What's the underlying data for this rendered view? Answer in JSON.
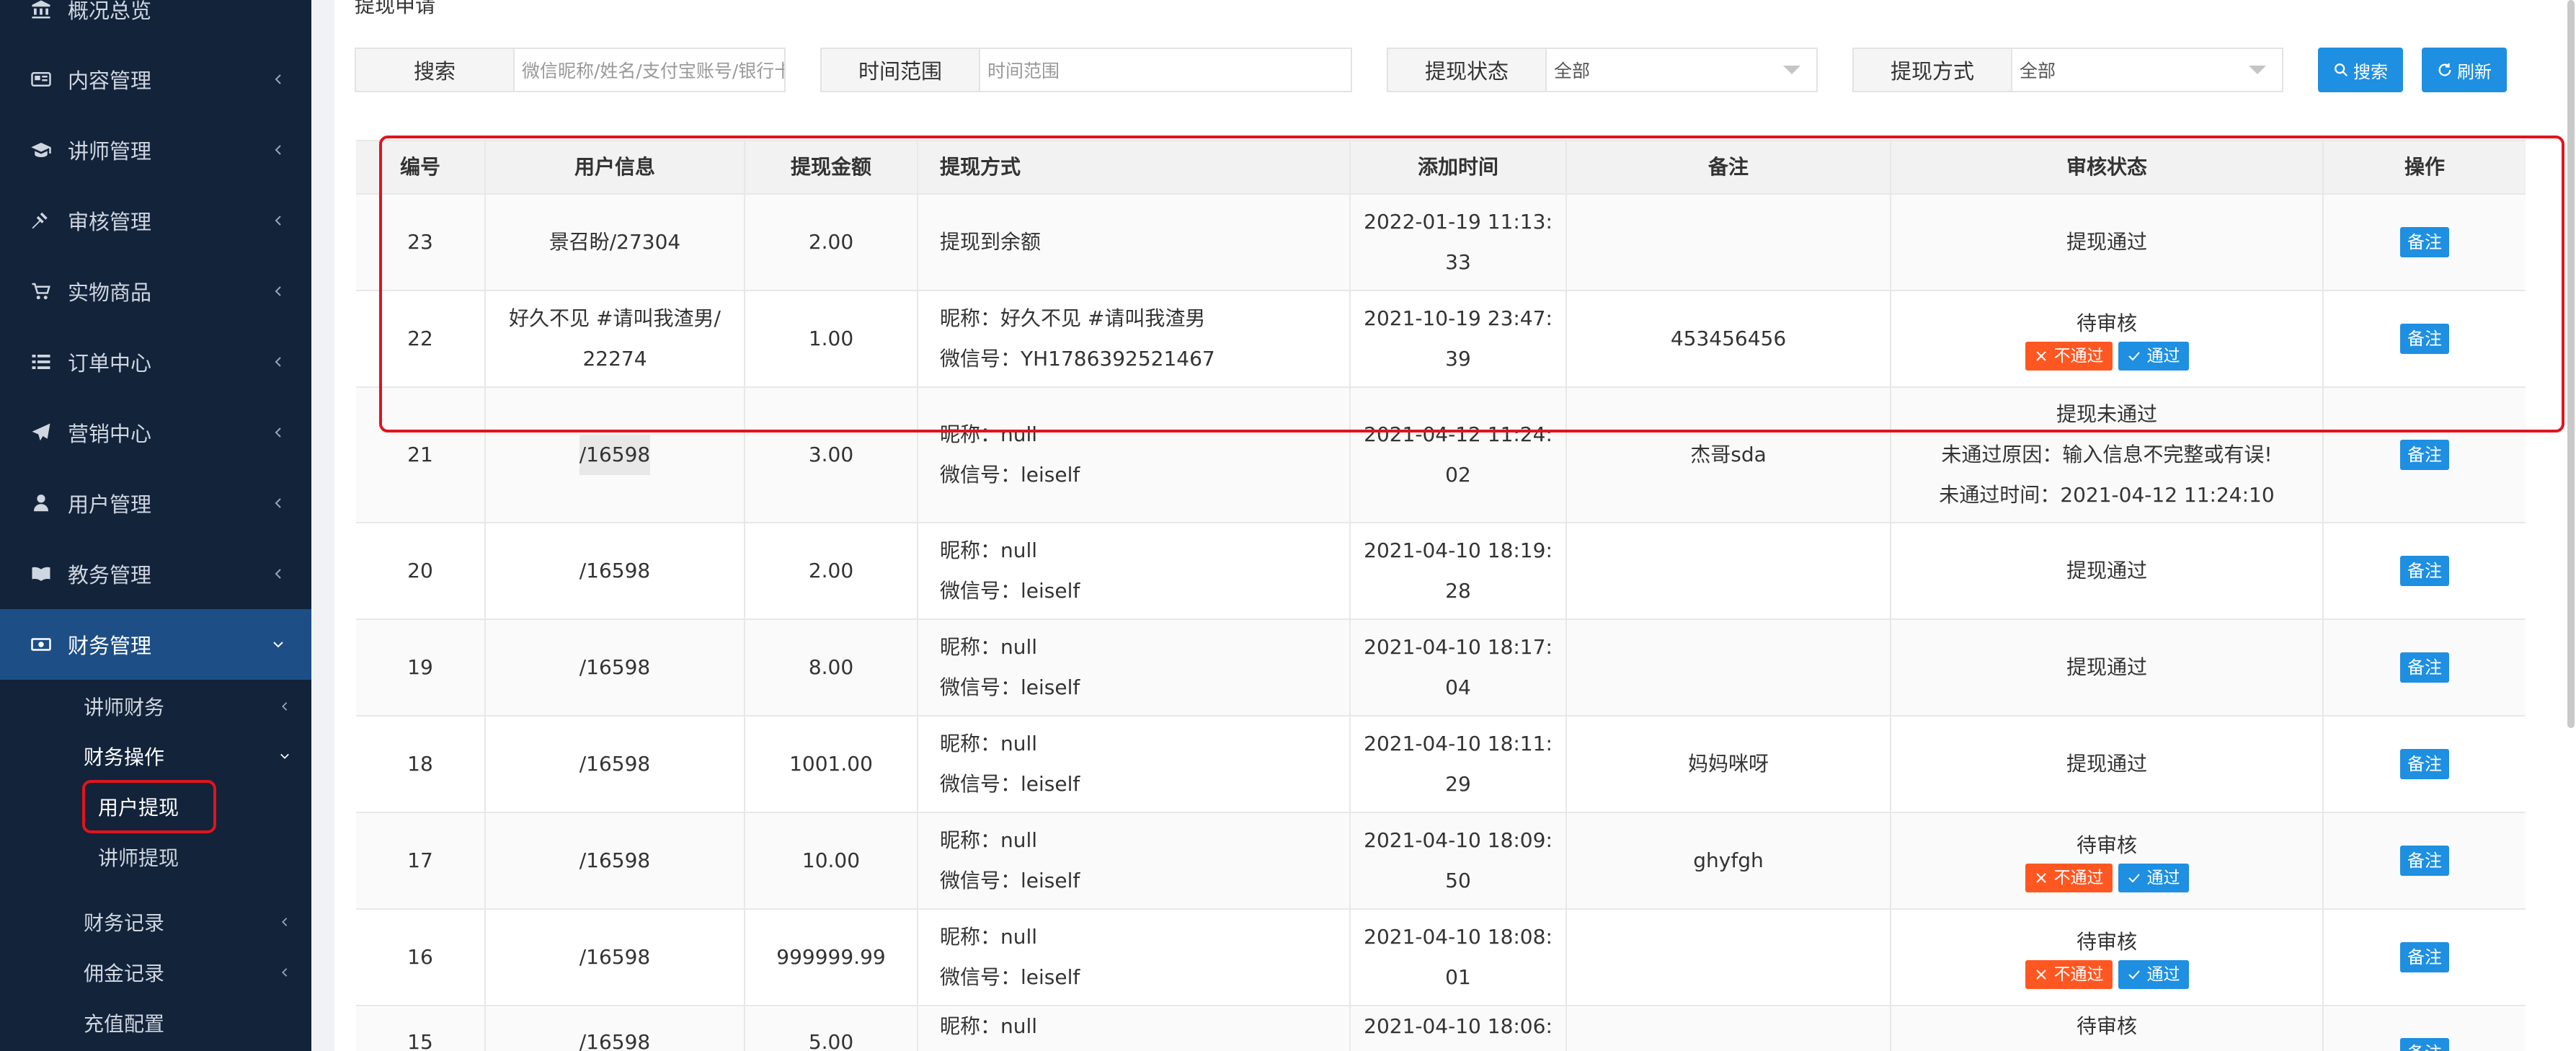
{
  "sidebar": {
    "items": [
      {
        "label": "概况总览",
        "icon": "bank-icon"
      },
      {
        "label": "内容管理",
        "icon": "newspaper-icon"
      },
      {
        "label": "讲师管理",
        "icon": "graduation-cap-icon"
      },
      {
        "label": "审核管理",
        "icon": "gavel-icon"
      },
      {
        "label": "实物商品",
        "icon": "cart-icon"
      },
      {
        "label": "订单中心",
        "icon": "list-icon"
      },
      {
        "label": "营销中心",
        "icon": "paper-plane-icon"
      },
      {
        "label": "用户管理",
        "icon": "user-icon"
      },
      {
        "label": "教务管理",
        "icon": "book-icon"
      },
      {
        "label": "财务管理",
        "icon": "money-icon"
      }
    ],
    "sub_items": [
      {
        "label": "讲师财务"
      },
      {
        "label": "财务操作"
      },
      {
        "label": "用户提现"
      },
      {
        "label": "讲师提现"
      },
      {
        "label": "财务记录"
      },
      {
        "label": "佣金记录"
      },
      {
        "label": "充值配置"
      }
    ]
  },
  "page": {
    "title": "提现申请"
  },
  "filters": {
    "search_label": "搜索",
    "search_placeholder": "微信昵称/姓名/支付宝账号/银行卡",
    "time_label": "时间范围",
    "time_placeholder": "时间范围",
    "status_label": "提现状态",
    "status_value": "全部",
    "method_label": "提现方式",
    "method_value": "全部",
    "search_btn": "搜索",
    "refresh_btn": "刷新"
  },
  "table": {
    "headers": [
      "编号",
      "用户信息",
      "提现金额",
      "提现方式",
      "添加时间",
      "备注",
      "审核状态",
      "操作"
    ],
    "note_btn": "备注",
    "reject_btn": "不通过",
    "pass_btn": "通过",
    "rows": [
      {
        "id": "23",
        "user1": "景召盼/27304",
        "user2": "",
        "amount": "2.00",
        "method1": "提现到余额",
        "method2": "",
        "time1": "2022-01-19 11:13:",
        "time2": "33",
        "note": "",
        "status": "提现通过",
        "reason": "",
        "reason_time": "",
        "pending": false
      },
      {
        "id": "22",
        "user1": "好久不见 #请叫我渣男/",
        "user2": "22274",
        "amount": "1.00",
        "method1": "昵称：好久不见 #请叫我渣男",
        "method2": "微信号：YH1786392521467",
        "time1": "2021-10-19 23:47:",
        "time2": "39",
        "note": "453456456",
        "status": "待审核",
        "reason": "",
        "reason_time": "",
        "pending": true
      },
      {
        "id": "21",
        "user1": "/16598",
        "user2": "",
        "amount": "3.00",
        "method1": "昵称：null",
        "method2": "微信号：leiself",
        "time1": "2021-04-12 11:24:",
        "time2": "02",
        "note": "杰哥sda",
        "status": "提现未通过",
        "reason": "未通过原因：输入信息不完整或有误!",
        "reason_time": "未通过时间：2021-04-12 11:24:10",
        "pending": false
      },
      {
        "id": "20",
        "user1": "/16598",
        "user2": "",
        "amount": "2.00",
        "method1": "昵称：null",
        "method2": "微信号：leiself",
        "time1": "2021-04-10 18:19:",
        "time2": "28",
        "note": "",
        "status": "提现通过",
        "reason": "",
        "reason_time": "",
        "pending": false
      },
      {
        "id": "19",
        "user1": "/16598",
        "user2": "",
        "amount": "8.00",
        "method1": "昵称：null",
        "method2": "微信号：leiself",
        "time1": "2021-04-10 18:17:",
        "time2": "04",
        "note": "",
        "status": "提现通过",
        "reason": "",
        "reason_time": "",
        "pending": false
      },
      {
        "id": "18",
        "user1": "/16598",
        "user2": "",
        "amount": "1001.00",
        "method1": "昵称：null",
        "method2": "微信号：leiself",
        "time1": "2021-04-10 18:11:",
        "time2": "29",
        "note": "妈妈咪呀",
        "status": "提现通过",
        "reason": "",
        "reason_time": "",
        "pending": false
      },
      {
        "id": "17",
        "user1": "/16598",
        "user2": "",
        "amount": "10.00",
        "method1": "昵称：null",
        "method2": "微信号：leiself",
        "time1": "2021-04-10 18:09:",
        "time2": "50",
        "note": "ghyfgh",
        "status": "待审核",
        "reason": "",
        "reason_time": "",
        "pending": true
      },
      {
        "id": "16",
        "user1": "/16598",
        "user2": "",
        "amount": "999999.99",
        "method1": "昵称：null",
        "method2": "微信号：leiself",
        "time1": "2021-04-10 18:08:",
        "time2": "01",
        "note": "",
        "status": "待审核",
        "reason": "",
        "reason_time": "",
        "pending": true
      },
      {
        "id": "15",
        "user1": "/16598",
        "user2": "",
        "amount": "5.00",
        "method1": "昵称：null",
        "method2": "",
        "time1": "2021-04-10 18:06:",
        "time2": "",
        "note": "",
        "status": "待审核",
        "reason": "",
        "reason_time": "",
        "pending": false
      }
    ]
  },
  "colors": {
    "sidebar_bg": "#12233a",
    "active_bg": "#1d4e86",
    "accent_blue": "#1e8fe1",
    "reject_orange": "#ff5722",
    "highlight_red": "#e0141e"
  }
}
